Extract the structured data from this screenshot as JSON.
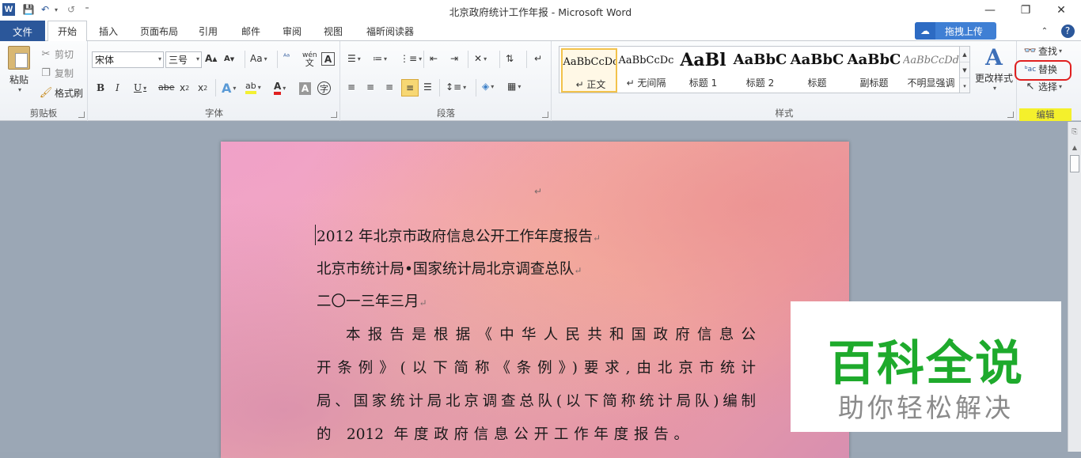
{
  "window": {
    "title": "北京政府统计工作年报 - Microsoft Word",
    "minimize": "—",
    "maximize": "❐",
    "close": "✕"
  },
  "quick_access": {
    "save_icon": "💾",
    "undo_icon": "↶",
    "redo_icon": "↺",
    "customize": "⁼"
  },
  "tabs": {
    "file": "文件",
    "items": [
      "开始",
      "插入",
      "页面布局",
      "引用",
      "邮件",
      "审阅",
      "视图",
      "福昕阅读器"
    ],
    "active": "开始",
    "upload_button": "拖拽上传"
  },
  "clipboard": {
    "label": "剪贴板",
    "paste": "粘贴",
    "cut": "剪切",
    "copy": "复制",
    "format_painter": "格式刷"
  },
  "font": {
    "label": "字体",
    "font_name": "宋体",
    "font_size": "三号"
  },
  "paragraph": {
    "label": "段落"
  },
  "styles": {
    "label": "样式",
    "items": [
      {
        "sample": "AaBbCcDc",
        "name": "↵ 正文"
      },
      {
        "sample": "AaBbCcDc",
        "name": "↵ 无间隔"
      },
      {
        "sample": "AaBl",
        "name": "标题 1"
      },
      {
        "sample": "AaBbC",
        "name": "标题 2"
      },
      {
        "sample": "AaBbC",
        "name": "标题"
      },
      {
        "sample": "AaBbC",
        "name": "副标题"
      },
      {
        "sample": "AaBbCcDd",
        "name": "不明显强调"
      }
    ],
    "change_styles": "更改样式"
  },
  "editing": {
    "label": "编辑",
    "find": "查找",
    "replace": "替换",
    "select": "选择"
  },
  "document": {
    "top_mark": "↵",
    "lines": [
      "2012 年北京市政府信息公开工作年度报告",
      "北京市统计局•国家统计局北京调查总队",
      "二〇一三年三月"
    ],
    "paragraph_lines": [
      "本报告是根据《中华人民共和国政府信息公",
      "开条例》(以下简称《条例》)要求,由北京市统计",
      "局、国家统计局北京调查总队(以下简称统计局队)编制",
      "的 2012 年度政府信息公开工作年度报告。"
    ],
    "para_mark": "↵"
  },
  "watermark": {
    "title": "百科全说",
    "subtitle": "助你轻松解决"
  }
}
